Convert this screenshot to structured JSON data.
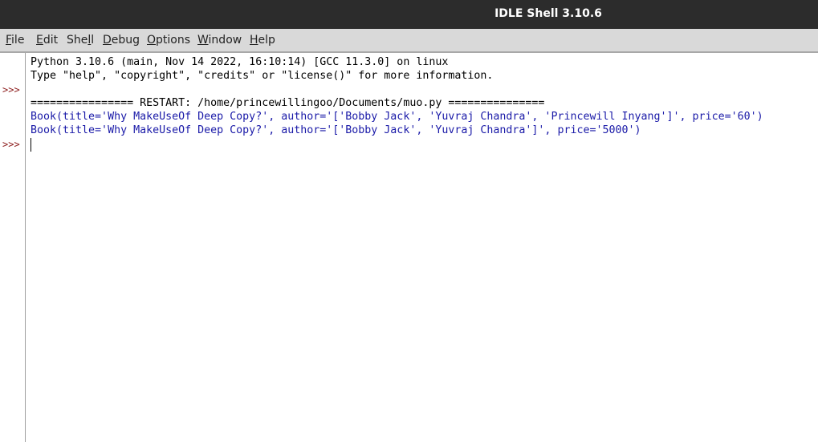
{
  "window": {
    "title": "IDLE Shell 3.10.6"
  },
  "menu": [
    {
      "pre": "",
      "u": "F",
      "post": "ile"
    },
    {
      "pre": "",
      "u": "E",
      "post": "dit"
    },
    {
      "pre": "She",
      "u": "l",
      "post": "l"
    },
    {
      "pre": "",
      "u": "D",
      "post": "ebug"
    },
    {
      "pre": "",
      "u": "O",
      "post": "ptions"
    },
    {
      "pre": "",
      "u": "W",
      "post": "indow"
    },
    {
      "pre": "",
      "u": "H",
      "post": "elp"
    }
  ],
  "gutter": {
    "prompts": [
      ">>>",
      ">>>"
    ]
  },
  "shell": {
    "lines": [
      "Python 3.10.6 (main, Nov 14 2022, 16:10:14) [GCC 11.3.0] on linux",
      "Type \"help\", \"copyright\", \"credits\" or \"license()\" for more information.",
      "================ RESTART: /home/princewillingoo/Documents/muo.py ===============",
      "Book(title='Why MakeUseOf Deep Copy?', author='['Bobby Jack', 'Yuvraj Chandra', 'Princewill Inyang']', price='60')",
      "Book(title='Why MakeUseOf Deep Copy?', author='['Bobby Jack', 'Yuvraj Chandra']', price='5000')"
    ]
  }
}
